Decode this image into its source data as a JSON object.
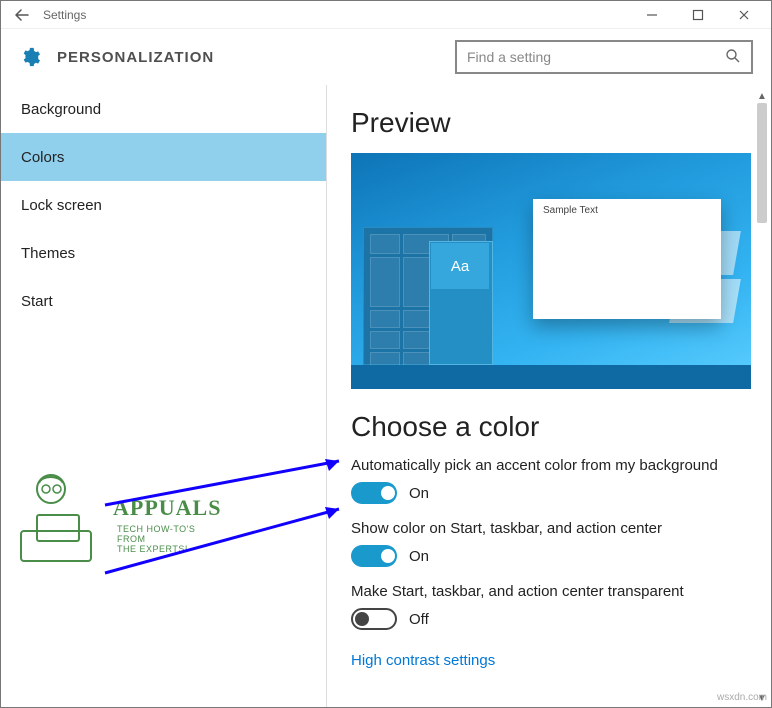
{
  "window": {
    "title": "Settings"
  },
  "header": {
    "page_title": "PERSONALIZATION",
    "search_placeholder": "Find a setting"
  },
  "sidebar": {
    "items": [
      {
        "label": "Background",
        "selected": false
      },
      {
        "label": "Colors",
        "selected": true
      },
      {
        "label": "Lock screen",
        "selected": false
      },
      {
        "label": "Themes",
        "selected": false
      },
      {
        "label": "Start",
        "selected": false
      }
    ]
  },
  "watermark": {
    "brand": "APPUALS",
    "tagline_l1": "TECH HOW-TO'S FROM",
    "tagline_l2": "THE EXPERTS!"
  },
  "main": {
    "preview_heading": "Preview",
    "preview_sample_text": "Sample Text",
    "preview_tile_text": "Aa",
    "choose_heading": "Choose a color",
    "settings": {
      "auto_accent": {
        "label": "Automatically pick an accent color from my background",
        "on": true,
        "value_text": "On"
      },
      "show_color": {
        "label": "Show color on Start, taskbar, and action center",
        "on": true,
        "value_text": "On"
      },
      "transparent": {
        "label": "Make Start, taskbar, and action center transparent",
        "on": false,
        "value_text": "Off"
      }
    },
    "link_text": "High contrast settings"
  },
  "source_text": "wsxdn.com"
}
